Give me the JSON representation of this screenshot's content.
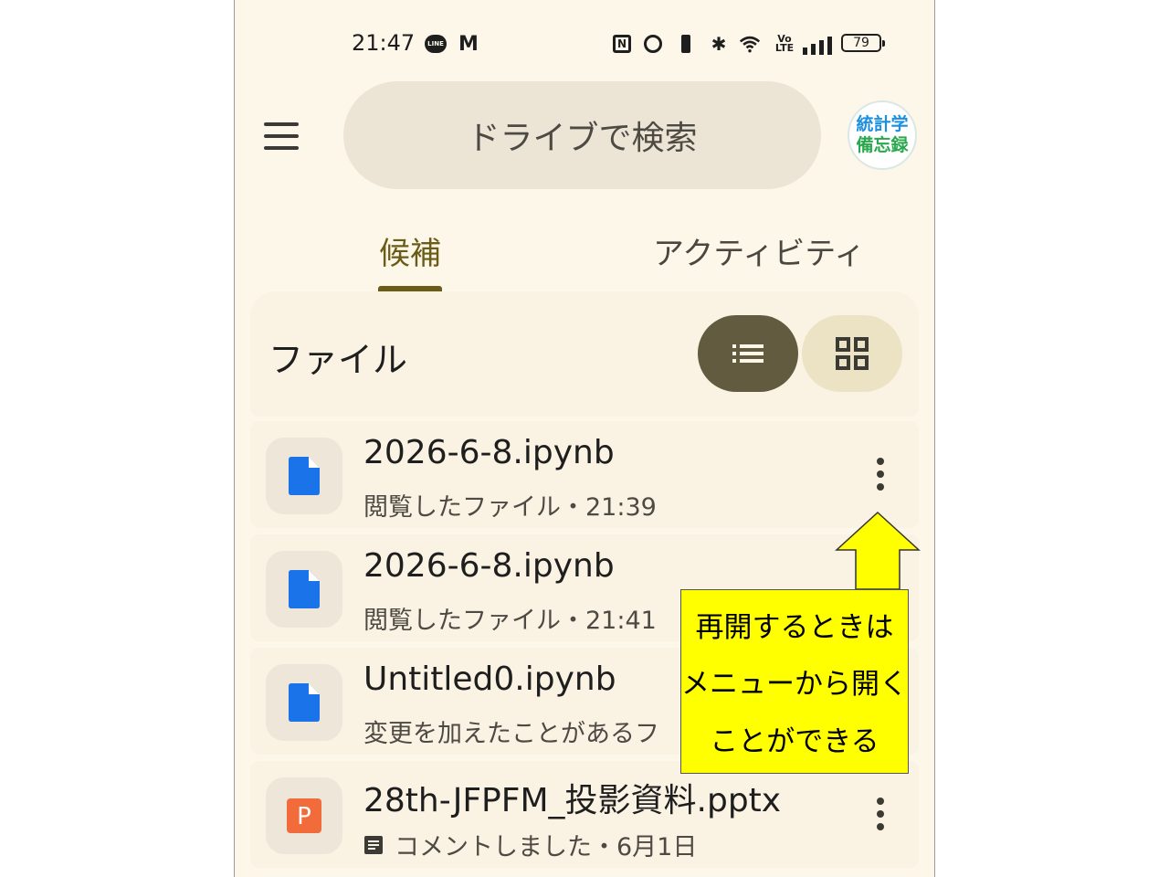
{
  "status_bar": {
    "time": "21:47",
    "line_label": "LINE",
    "gmail_label": "M",
    "nfc_label": "N",
    "volte_label": "Vo LTE",
    "battery": "79",
    "icons": [
      "line-icon",
      "gmail-icon",
      "nfc-icon",
      "alarm-icon",
      "vibrate-icon",
      "bluetooth-icon",
      "wifi-icon",
      "volte-icon",
      "signal-icon",
      "battery-icon"
    ]
  },
  "header": {
    "search_placeholder": "ドライブで検索",
    "avatar_line1": "統計学",
    "avatar_line2": "備忘録"
  },
  "tabs": [
    {
      "label": "候補",
      "selected": true
    },
    {
      "label": "アクティビティ",
      "selected": false
    }
  ],
  "section": {
    "title": "ファイル",
    "view_mode": "list"
  },
  "files": [
    {
      "name": "2026-6-8.ipynb",
      "meta": "閲覧したファイル・21:39",
      "type": "doc",
      "icon_color": "#1a73e8"
    },
    {
      "name": "2026-6-8.ipynb",
      "meta": "閲覧したファイル・21:41",
      "type": "doc",
      "icon_color": "#1a73e8"
    },
    {
      "name": "Untitled0.ipynb",
      "meta": "変更を加えたことがあるフ",
      "type": "doc",
      "icon_color": "#1a73e8"
    },
    {
      "name": "28th-JFPFM_投影資料.pptx",
      "meta": "コメントしました・6月1日",
      "type": "slides",
      "icon_letter": "P",
      "icon_color": "#f26b3a"
    }
  ],
  "annotation": {
    "line1": "再開するときは",
    "line2": "メニューから開く",
    "line3": "ことができる",
    "color": "#ffff00"
  }
}
